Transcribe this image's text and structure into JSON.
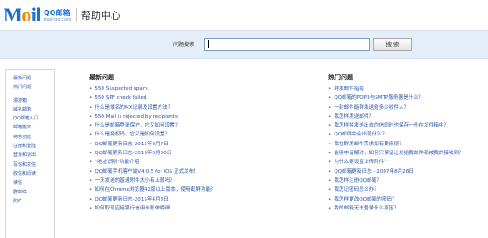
{
  "header": {
    "logo_main": "M",
    "logo_o": "o",
    "logo_rest": "il",
    "logo_qq": "QQ邮箱",
    "logo_url": "mail.qq.com",
    "title": "帮助中心"
  },
  "search": {
    "label": "问题搜索",
    "value": "",
    "button_label": "搜 索"
  },
  "sidebar": {
    "items": [
      "最新问题",
      "热门问题",
      "漫游箱",
      "域名邮箱",
      "QQ邮箱入门",
      "邮箱搬家",
      "特色功能",
      "注册和登陆",
      "登录和退出",
      "写信和发信",
      "收信和阅读",
      "读信",
      "群邮件",
      "附件"
    ]
  },
  "latest": {
    "title": "最新问题",
    "items": [
      "550 Suspected spam.",
      "550 SPF check failed",
      "什么是域名的MX记录及设置方法？",
      "550 Mail is rejected by recipients.",
      "什么是邮箱登录保护，它又如何设置？",
      "什么是授权码，它又是如何设置？",
      "QQ邮箱更新日志-2015年8月7日",
      "QQ邮箱更新日志-2015年6月30日",
      "\"地址识别\"功能介绍",
      "QQ邮箱手机客户端V4.0.5 for iOS 正式发布！",
      "一天发送的普通附件大小有上限吗？",
      "如何在Chrome浏览器42版以上版本，使用截屏功能？",
      "QQ邮箱更新日志-2015年4月8日",
      "如何取现应用银行信用卡账单明细"
    ]
  },
  "popular": {
    "title": "热门问题",
    "items": [
      "群发邮件指南",
      "QQ邮箱的POP3与SMTP服务器是什么？",
      "一封邮件能群发送给多少收件人？",
      "我怎样发送邮件？",
      "我怎样将发送出去的信同时也保存一份在发件箱中？",
      "QQ邮件中会出现什么？",
      "我在群发邮件需求如有要麻烦？",
      "能够申请解封，如何只保证让发给我邮件都被我的接收到？",
      "为什么要设置上传附件？",
      "QQ邮箱更新日志 - 2007年8月28日",
      "我怎样注册QQ邮箱？",
      "我怎记密码怎么办？",
      "我怎样更改QQ邮箱的密码？",
      "我的邮箱无法登录什么原因？"
    ]
  }
}
